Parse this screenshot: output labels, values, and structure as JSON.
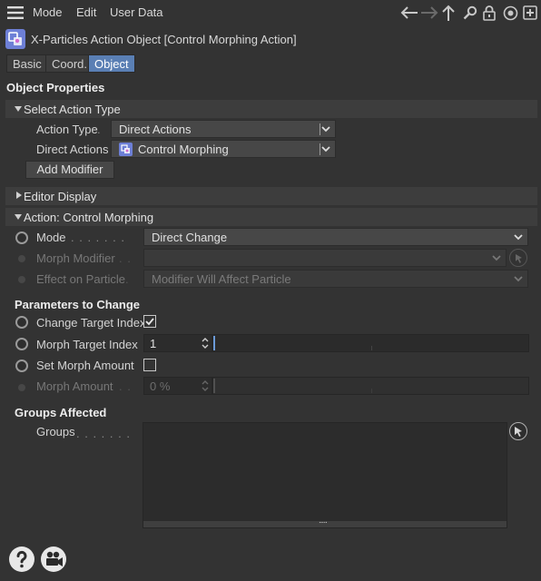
{
  "menu": {
    "items": [
      "Mode",
      "Edit",
      "User Data"
    ]
  },
  "nav_icons": [
    "back-arrow-icon",
    "forward-arrow-icon",
    "up-arrow-icon",
    "search-icon",
    "lock-icon",
    "target-icon",
    "new-window-icon"
  ],
  "title": "X-Particles Action Object [Control Morphing Action]",
  "tabs": [
    {
      "label": "Basic",
      "active": false
    },
    {
      "label": "Coord.",
      "active": false
    },
    {
      "label": "Object",
      "active": true
    }
  ],
  "object_properties": {
    "heading": "Object Properties",
    "select_action_type": {
      "header": "Select Action Type",
      "action_type_label": "Action Type",
      "action_type_value": "Direct Actions",
      "direct_actions_label": "Direct Actions",
      "direct_actions_value": "Control Morphing",
      "add_modifier": "Add Modifier"
    },
    "editor_display": {
      "header": "Editor Display"
    },
    "action": {
      "header": "Action: Control Morphing",
      "mode_label": "Mode",
      "mode_value": "Direct Change",
      "morph_modifier_label": "Morph Modifier",
      "morph_modifier_value": "",
      "effect_label": "Effect on Particle",
      "effect_value": "Modifier Will Affect Particle"
    }
  },
  "parameters": {
    "heading": "Parameters to Change",
    "change_target_index_label": "Change Target Index",
    "change_target_index_checked": true,
    "morph_target_index_label": "Morph Target Index",
    "morph_target_index_value": "1",
    "set_morph_amount_label": "Set Morph Amount",
    "set_morph_amount_checked": false,
    "morph_amount_label": "Morph Amount",
    "morph_amount_value": "0 %"
  },
  "groups": {
    "heading": "Groups Affected",
    "groups_label": "Groups"
  },
  "bottom_icons": [
    "help-icon",
    "record-icon"
  ],
  "colors": {
    "background": "#333333",
    "active_tab": "#5a7fb4",
    "object_icon": "#7b8fe0"
  }
}
